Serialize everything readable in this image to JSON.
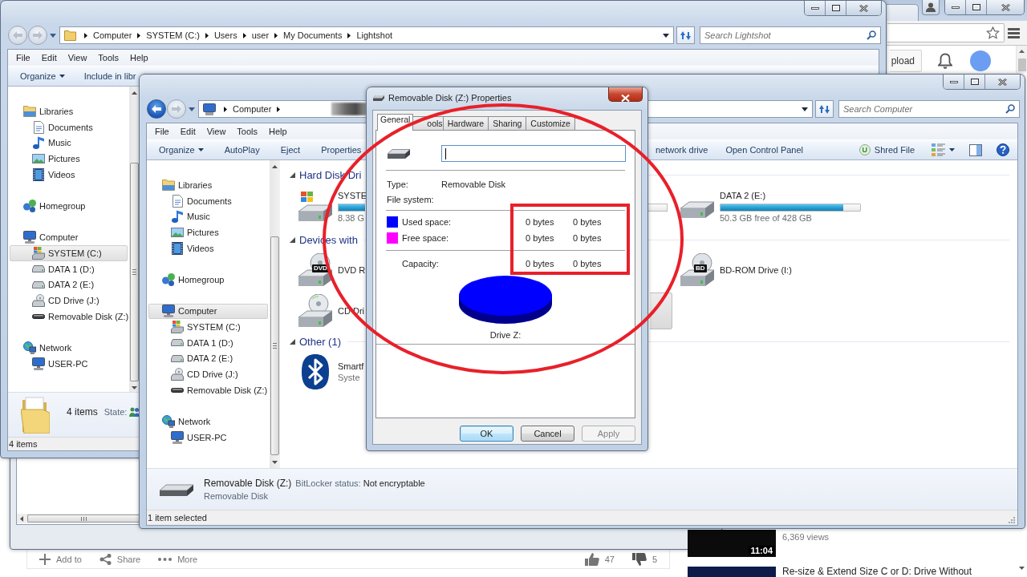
{
  "browser": {
    "upload_button": "pload",
    "actions": [
      {
        "kind": "add",
        "label": "Add to"
      },
      {
        "kind": "share",
        "label": "Share"
      },
      {
        "kind": "more",
        "label": "More"
      }
    ],
    "likes": "47",
    "dislikes": "5",
    "related_videos": [
      {
        "duration": "11:04",
        "views": "6,369 views"
      },
      {
        "title": "Re-size & Extend Size C or D: Drive Without"
      }
    ]
  },
  "lightshot_window": {
    "back_button": {
      "disabled": true
    },
    "forward_button": {
      "disabled": true
    },
    "breadcrumb": [
      "Computer",
      "SYSTEM (C:)",
      "Users",
      "user",
      "My Documents",
      "Lightshot"
    ],
    "trailing_arrow": false,
    "search": {
      "placeholder": "Search Lightshot"
    },
    "menu": [
      "File",
      "Edit",
      "View",
      "Tools",
      "Help"
    ],
    "toolbar": [
      {
        "label": "Organize",
        "dropdown": true
      },
      {
        "label": "Include in libr",
        "dropdown": false
      }
    ],
    "nav": [
      {
        "label": "Libraries",
        "kind": "libraries",
        "selected": false,
        "children": [
          {
            "label": "Documents",
            "kind": "documents",
            "selected": false
          },
          {
            "label": "Music",
            "kind": "music",
            "selected": false
          },
          {
            "label": "Pictures",
            "kind": "pictures",
            "selected": false
          },
          {
            "label": "Videos",
            "kind": "videos",
            "selected": false
          }
        ]
      },
      {
        "label": "Homegroup",
        "kind": "homegroup",
        "selected": false
      },
      {
        "label": "Computer",
        "kind": "computer",
        "selected": false,
        "children": [
          {
            "label": "SYSTEM (C:)",
            "kind": "system-drive",
            "selected": true
          },
          {
            "label": "DATA 1 (D:)",
            "kind": "drive",
            "selected": false
          },
          {
            "label": "DATA 2 (E:)",
            "kind": "drive",
            "selected": false
          },
          {
            "label": "CD Drive (J:)",
            "kind": "cd-drive",
            "selected": false
          },
          {
            "label": "Removable Disk (Z:)",
            "kind": "removable-drive",
            "selected": false
          }
        ]
      },
      {
        "label": "Network",
        "kind": "network",
        "selected": false,
        "children": [
          {
            "label": "USER-PC",
            "kind": "pc",
            "selected": false
          }
        ]
      }
    ],
    "details": {
      "summary": "4 items",
      "state_label": "State:"
    },
    "status_bar": "4 items"
  },
  "computer_window": {
    "back_button": {
      "disabled": false
    },
    "forward_button": {
      "disabled": true
    },
    "breadcrumb": [
      "Computer"
    ],
    "trailing_arrow": true,
    "search": {
      "placeholder": "Search Computer"
    },
    "menu": [
      "File",
      "Edit",
      "View",
      "Tools",
      "Help"
    ],
    "toolbar": [
      {
        "label": "Organize",
        "dropdown": true
      },
      {
        "label": "AutoPlay",
        "dropdown": false
      },
      {
        "label": "Eject",
        "dropdown": false
      },
      {
        "label": "Properties",
        "dropdown": false
      }
    ],
    "toolbar_right": [
      {
        "kind": "text",
        "label": "network drive"
      },
      {
        "kind": "text",
        "label": "Open Control Panel"
      },
      {
        "kind": "shred",
        "badge": "U",
        "label": "Shred File"
      }
    ],
    "nav": [
      {
        "label": "Libraries",
        "kind": "libraries",
        "selected": false,
        "children": [
          {
            "label": "Documents",
            "kind": "documents",
            "selected": false
          },
          {
            "label": "Music",
            "kind": "music",
            "selected": false
          },
          {
            "label": "Pictures",
            "kind": "pictures",
            "selected": false
          },
          {
            "label": "Videos",
            "kind": "videos",
            "selected": false
          }
        ]
      },
      {
        "label": "Homegroup",
        "kind": "homegroup",
        "selected": false
      },
      {
        "label": "Computer",
        "kind": "computer",
        "selected": true,
        "children": [
          {
            "label": "SYSTEM (C:)",
            "kind": "system-drive",
            "selected": false
          },
          {
            "label": "DATA 1 (D:)",
            "kind": "drive",
            "selected": false
          },
          {
            "label": "DATA 2 (E:)",
            "kind": "drive",
            "selected": false
          },
          {
            "label": "CD Drive (J:)",
            "kind": "cd-drive",
            "selected": false
          },
          {
            "label": "Removable Disk (Z:)",
            "kind": "removable-drive",
            "selected": false
          }
        ]
      },
      {
        "label": "Network",
        "kind": "network",
        "selected": false,
        "children": [
          {
            "label": "USER-PC",
            "kind": "pc",
            "selected": false
          }
        ]
      }
    ],
    "groups": [
      {
        "heading": "Hard Disk Dri",
        "items": [
          {
            "kind": "system-drive",
            "name": "SYSTE",
            "free": "8.38 G",
            "selected": false
          },
          {
            "kind": "covered-drive"
          },
          {
            "kind": "drive",
            "name": "DATA 2 (E:)",
            "level": 0.88,
            "free": "50.3 GB free of 428 GB",
            "selected": false
          }
        ]
      },
      {
        "heading": "Devices with",
        "items": [
          {
            "kind": "optical-drive",
            "badge": "DVD",
            "name": "DVD R",
            "selected": false
          },
          {
            "kind": "covered"
          },
          {
            "kind": "optical-drive",
            "badge": "BD",
            "name": "BD-ROM Drive (I:)",
            "selected": false
          },
          {
            "kind": "cd-drive",
            "name": "CD Dri",
            "selected": false
          },
          {
            "kind": "covered",
            "selected": true
          }
        ]
      },
      {
        "heading": "Other (1)",
        "items": [
          {
            "kind": "bluetooth",
            "name": "Smartf",
            "subtitle": "Syste",
            "selected": false
          }
        ]
      }
    ],
    "details": {
      "name": "Removable Disk (Z:)",
      "field_label": "BitLocker status:",
      "field_value": "Not encryptable",
      "type": "Removable Disk"
    },
    "status_bar": "1 item selected"
  },
  "properties_dialog": {
    "title": "Removable Disk (Z:) Properties",
    "tabs": [
      {
        "label": "General",
        "selected": true
      },
      {
        "label": "ools",
        "selected": false
      },
      {
        "label": "Hardware",
        "selected": false
      },
      {
        "label": "Sharing",
        "selected": false
      },
      {
        "label": "Customize",
        "selected": false
      }
    ],
    "name_field": {
      "focused": true
    },
    "info": [
      {
        "label": "Type:",
        "value": "Removable Disk"
      },
      {
        "label": "File system:"
      }
    ],
    "space": [
      {
        "label": "Used space:",
        "color": "#0000ff",
        "bytes": "0 bytes",
        "size": "0 bytes"
      },
      {
        "label": "Free space:",
        "color": "#ff00ff",
        "bytes": "0 bytes",
        "size": "0 bytes"
      }
    ],
    "capacity": {
      "label": "Capacity:",
      "bytes": "0 bytes",
      "size": "0 bytes"
    },
    "drive_label": "Drive Z:",
    "buttons": [
      {
        "label": "OK",
        "default": true,
        "disabled": false
      },
      {
        "label": "Cancel",
        "default": false,
        "disabled": false
      },
      {
        "label": "Apply",
        "default": false,
        "disabled": true
      }
    ]
  },
  "annotations": [
    {
      "kind": "ellipse"
    },
    {
      "kind": "rectangle"
    }
  ]
}
